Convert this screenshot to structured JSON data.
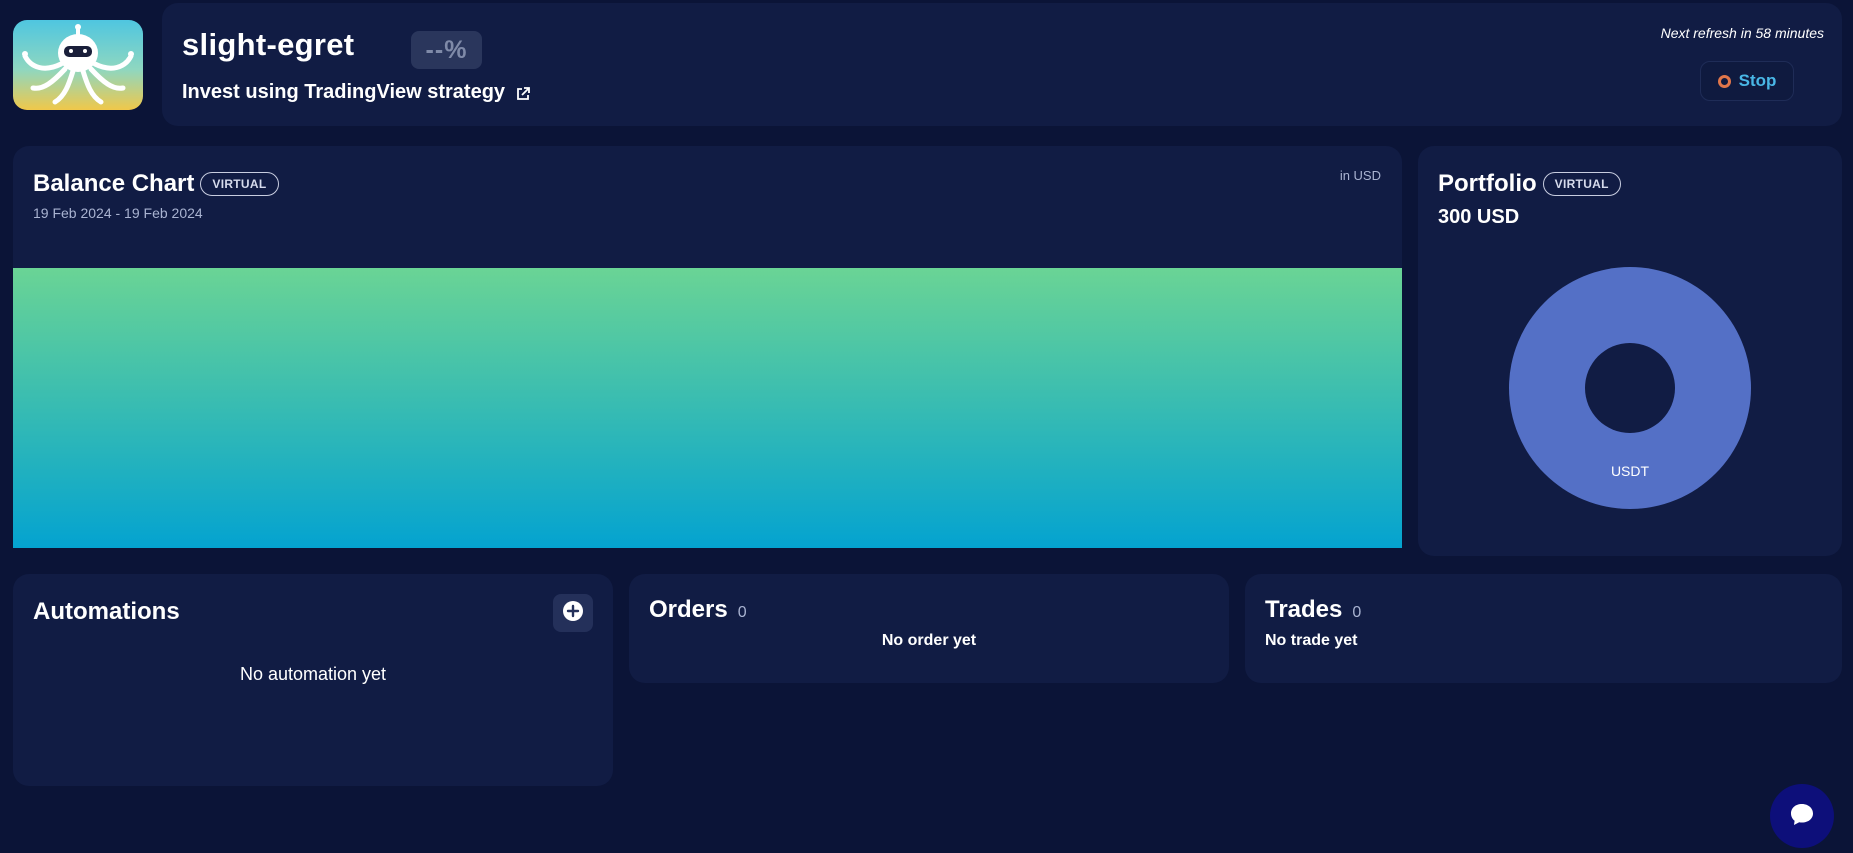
{
  "header": {
    "bot_name": "slight-egret",
    "performance": "--%",
    "strategy_link": "Invest using TradingView strategy",
    "refresh_text": "Next refresh in 58 minutes",
    "stop_label": "Stop",
    "icons": {
      "logo": "octopus-robot-logo",
      "external": "external-link-icon",
      "stop": "stop-circle-icon"
    }
  },
  "balance_chart": {
    "title": "Balance Chart",
    "badge": "VIRTUAL",
    "date_range": "19 Feb 2024 - 19 Feb 2024",
    "unit": "in USD"
  },
  "portfolio": {
    "title": "Portfolio",
    "badge": "VIRTUAL",
    "total": "300 USD",
    "slices": [
      {
        "label": "USDT",
        "share": 1.0,
        "color": "#5470c6"
      }
    ]
  },
  "automations": {
    "title": "Automations",
    "empty": "No automation yet",
    "add_icon": "plus-circle-icon"
  },
  "orders": {
    "title": "Orders",
    "count": "0",
    "empty": "No order yet"
  },
  "trades": {
    "title": "Trades",
    "count": "0",
    "empty": "No trade yet"
  },
  "colors": {
    "background": "#0b1437",
    "card": "#111c44",
    "chart_top": "#6ad495",
    "chart_bottom": "#04a3d0",
    "accent_blue": "#49b7e6",
    "stop_orange": "#e0764a",
    "chat_bubble": "#0d0f7a"
  },
  "chat": {
    "icon": "chat-bubble-icon"
  }
}
